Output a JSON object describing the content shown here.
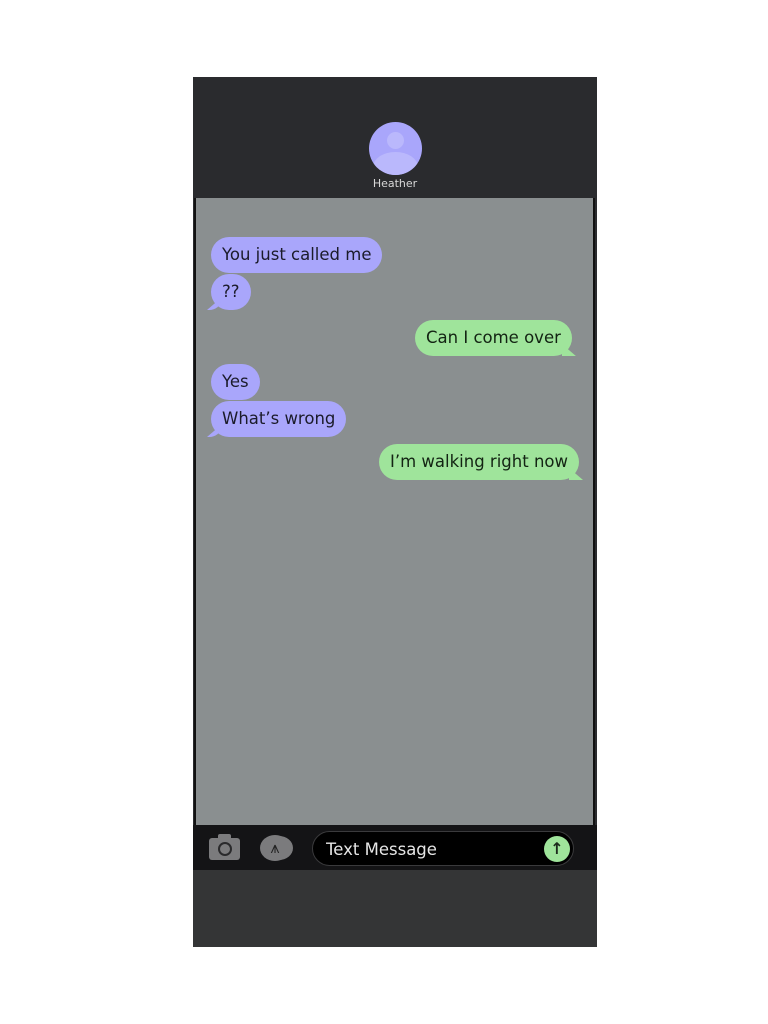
{
  "contact": {
    "name": "Heather",
    "avatar_icon": "person-icon"
  },
  "messages": [
    {
      "direction": "incoming",
      "text": "You just called me"
    },
    {
      "direction": "incoming",
      "text": "??"
    },
    {
      "direction": "outgoing",
      "text": "Can I come over"
    },
    {
      "direction": "incoming",
      "text": "Yes"
    },
    {
      "direction": "incoming",
      "text": "What’s wrong"
    },
    {
      "direction": "outgoing",
      "text": "I’m walking right now"
    }
  ],
  "input_bar": {
    "camera_icon": "camera-icon",
    "apps_icon": "app-store-icon",
    "placeholder": "Text Message",
    "value": "",
    "send_icon": "arrow-up-icon"
  },
  "colors": {
    "incoming": "#a9a6fb",
    "outgoing": "#9fe49b",
    "chat_bg": "#8a8f90",
    "frame": "#2a2b2e"
  }
}
